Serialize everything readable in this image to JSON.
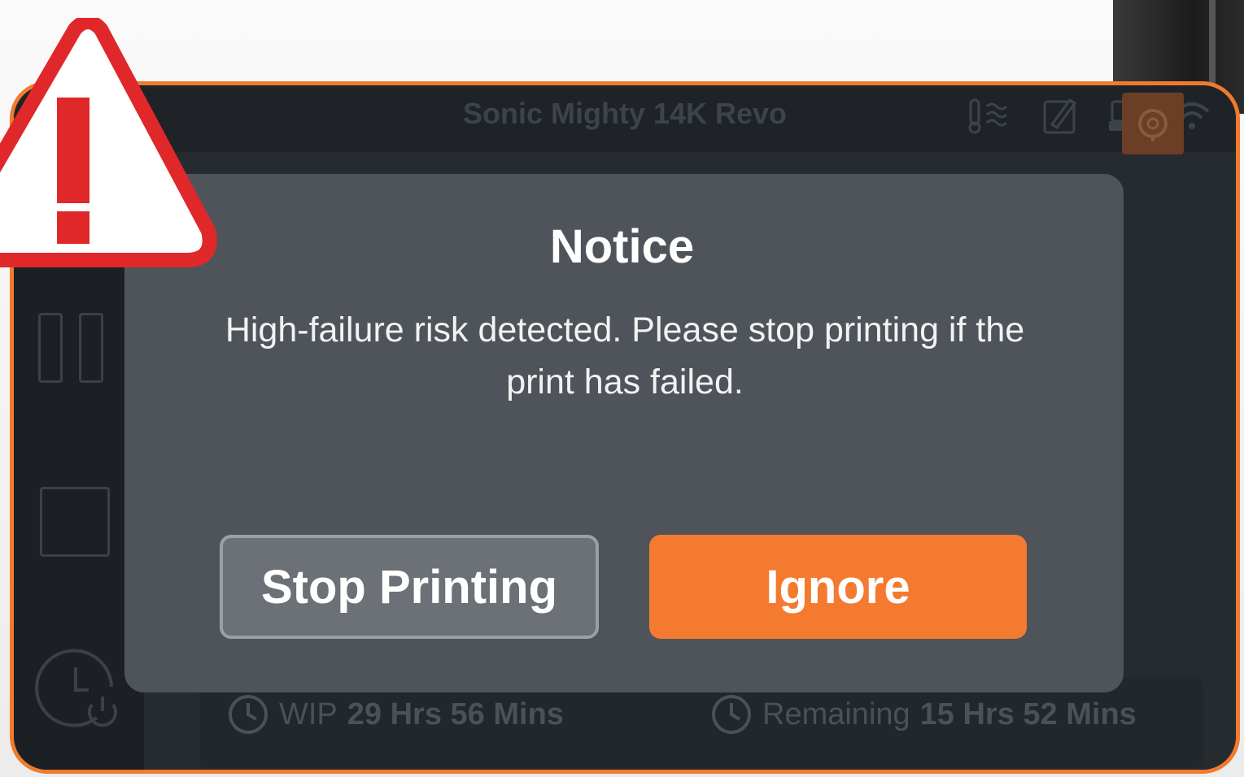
{
  "header": {
    "device_title": "Sonic Mighty 14K Revo",
    "status_icons": [
      "thermometer-icon",
      "edit-icon",
      "printer-icon",
      "wifi-icon"
    ]
  },
  "side_panel": {
    "pause_icon": "pause-icon",
    "stop_icon": "stop-icon",
    "clock_icon": "clock-power-icon",
    "right_button_icon": "camera-icon"
  },
  "status": {
    "wip_label": "WIP",
    "wip_value": "29 Hrs 56 Mins",
    "remaining_label": "Remaining",
    "remaining_value": "15 Hrs 52 Mins"
  },
  "dialog": {
    "title": "Notice",
    "message": "High-failure risk detected. Please stop printing if the print has failed.",
    "stop_button": "Stop Printing",
    "ignore_button": "Ignore"
  },
  "colors": {
    "accent": "#f47a30",
    "warning_red": "#e0282a",
    "dialog_bg": "#4e545a"
  },
  "overlay": {
    "warning_icon": "warning-triangle-icon"
  }
}
